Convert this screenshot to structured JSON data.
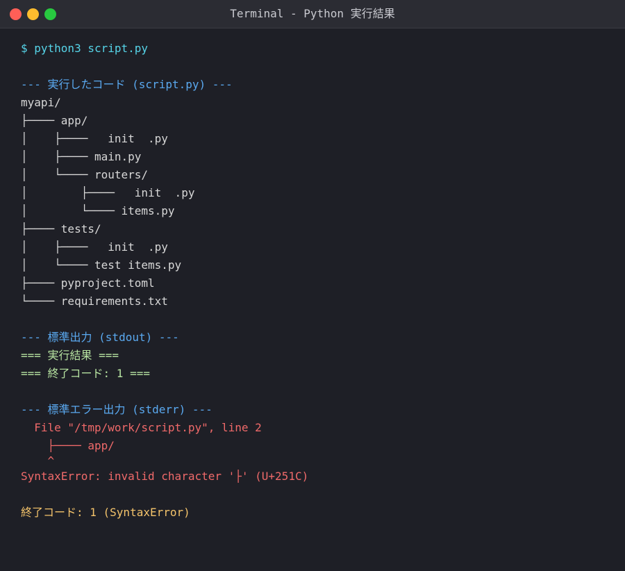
{
  "window": {
    "title": "Terminal - Python 実行結果",
    "colors": {
      "close": "#ff5f57",
      "minimize": "#febc2e",
      "maximize": "#28c840"
    }
  },
  "terminal": {
    "colors": {
      "prompt": "#56d4e8",
      "header": "#5aa9f0",
      "text": "#d8d8d8",
      "stdout": "#b7e3a1",
      "error": "#f06a6a",
      "exit": "#f5c46b"
    },
    "command": "$ python3 script.py",
    "code_header": "--- 実行したコード (script.py) ---",
    "code_lines": [
      "myapi/",
      "├──── app/",
      "│    ├────   init  .py",
      "│    ├──── main.py",
      "│    └──── routers/",
      "│        ├────   init  .py",
      "│        └──── items.py",
      "├──── tests/",
      "│    ├────   init  .py",
      "│    └──── test items.py",
      "├──── pyproject.toml",
      "└──── requirements.txt"
    ],
    "stdout_header": "--- 標準出力 (stdout) ---",
    "stdout_lines": [
      "=== 実行結果 ===",
      "=== 終了コード: 1 ==="
    ],
    "stderr_header": "--- 標準エラー出力 (stderr) ---",
    "stderr_lines": [
      "  File \"/tmp/work/script.py\", line 2",
      "    ├──── app/",
      "    ^"
    ],
    "error_message": "SyntaxError: invalid character '├' (U+251C)",
    "exit_line": "終了コード: 1 (SyntaxError)"
  }
}
